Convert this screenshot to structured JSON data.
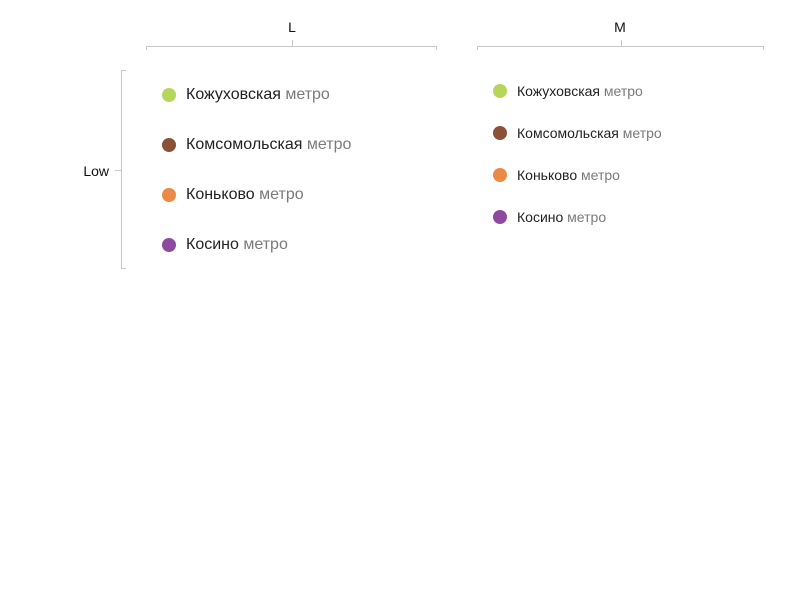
{
  "columns": [
    {
      "label": "L"
    },
    {
      "label": "M"
    }
  ],
  "rows": [
    {
      "label": "Low"
    }
  ],
  "legend_suffix": "метро",
  "panels": {
    "L": {
      "items": [
        {
          "name": "Кожуховская",
          "color": "#b5d65a"
        },
        {
          "name": "Комсомольская",
          "color": "#8a5038"
        },
        {
          "name": "Коньково",
          "color": "#ea8a45"
        },
        {
          "name": "Косино",
          "color": "#8e4a9e"
        }
      ]
    },
    "M": {
      "items": [
        {
          "name": "Кожуховская",
          "color": "#b5d65a"
        },
        {
          "name": "Комсомольская",
          "color": "#8a5038"
        },
        {
          "name": "Коньково",
          "color": "#ea8a45"
        },
        {
          "name": "Косино",
          "color": "#8e4a9e"
        }
      ]
    }
  }
}
